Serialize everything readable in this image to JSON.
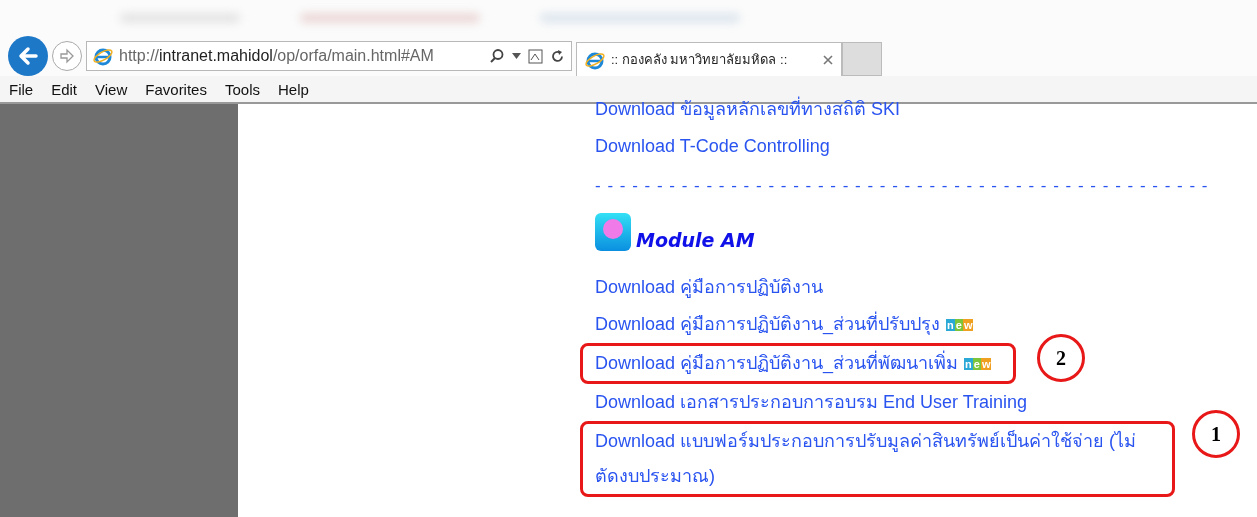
{
  "browser": {
    "address": "http://**intranet.mahidol**/op/orfa/main.html#AM",
    "tab_title": ":: กองคลัง มหาวิทยาลัยมหิดล ::"
  },
  "menu": [
    "File",
    "Edit",
    "View",
    "Favorites",
    "Tools",
    "Help"
  ],
  "content": [
    {
      "kind": "link",
      "text": "Download ข้อมูลหลักเลขที่ทางสถิติ SKI",
      "highlighted": false
    },
    {
      "kind": "link",
      "text": "Download T-Code Controlling",
      "highlighted": false
    },
    {
      "kind": "divider",
      "text": "- - - - - - - - - - - - - - - - - - - - - - - - - - - - - - - - - - - - - - - - - - - - - - - - - -"
    },
    {
      "kind": "heading",
      "text": "Module AM"
    },
    {
      "kind": "link",
      "text": "Download คู่มือการปฏิบัติงาน",
      "highlighted": false
    },
    {
      "kind": "link",
      "text": "Download คู่มือการปฏิบัติงาน_ส่วนที่ปรับปรุง",
      "badge": "new",
      "highlighted": false
    },
    {
      "kind": "link",
      "text": "Download คู่มือการปฏิบัติงาน_ส่วนที่พัฒนาเพิ่ม",
      "badge": "new",
      "highlighted": true
    },
    {
      "kind": "link",
      "text": "Download เอกสารประกอบการอบรม End User Training",
      "highlighted": false
    },
    {
      "kind": "link",
      "text": "Download แบบฟอร์มประกอบการปรับมูลค่าสินทรัพย์เป็นค่าใช้จ่าย (ไม่ตัดงบประมาณ)",
      "highlighted": true
    }
  ],
  "annotations": [
    {
      "label": "2"
    },
    {
      "label": "1"
    }
  ]
}
